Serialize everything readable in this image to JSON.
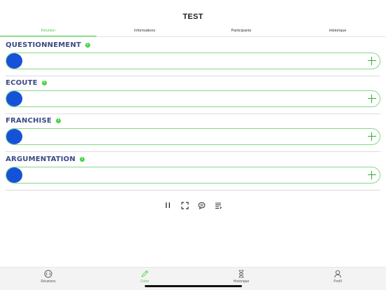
{
  "header": {
    "title": "TEST"
  },
  "tabs": [
    {
      "label": "Réunion",
      "active": true
    },
    {
      "label": "Informations",
      "active": false
    },
    {
      "label": "Participants",
      "active": false
    },
    {
      "label": "Historique",
      "active": false
    }
  ],
  "sections": [
    {
      "name": "QUESTIONNEMENT",
      "info": "i",
      "level": 0
    },
    {
      "name": "ECOUTE",
      "info": "i",
      "level": 0
    },
    {
      "name": "FRANCHISE",
      "info": "i",
      "level": 0
    },
    {
      "name": "ARGUMENTATION",
      "info": "i",
      "level": 0
    }
  ],
  "controls": [
    {
      "icon": "pause-icon"
    },
    {
      "icon": "fullscreen-icon"
    },
    {
      "icon": "chat-icon"
    },
    {
      "icon": "list-icon"
    }
  ],
  "bottom_nav": [
    {
      "label": "Réunions",
      "icon": "meetings-icon",
      "active": false
    },
    {
      "label": "Créer",
      "icon": "pencil-icon",
      "active": true
    },
    {
      "label": "Historique",
      "icon": "hourglass-icon",
      "active": false
    },
    {
      "label": "Profil",
      "icon": "person-icon",
      "active": false
    }
  ],
  "colors": {
    "accent": "#4ad24a",
    "knob": "#1652d8",
    "section_title": "#3a4a84"
  }
}
